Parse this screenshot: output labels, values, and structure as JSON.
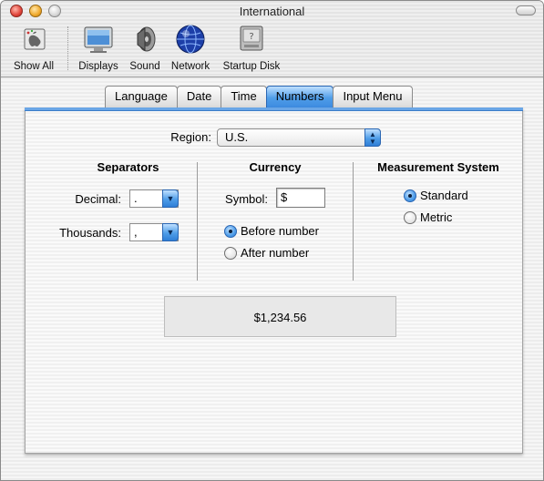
{
  "window": {
    "title": "International"
  },
  "toolbar": {
    "items": [
      {
        "label": "Show All",
        "icon": "apple-icon"
      },
      {
        "label": "Displays",
        "icon": "display-icon"
      },
      {
        "label": "Sound",
        "icon": "speaker-icon"
      },
      {
        "label": "Network",
        "icon": "globe-icon"
      },
      {
        "label": "Startup Disk",
        "icon": "disk-icon"
      }
    ]
  },
  "tabs": [
    {
      "label": "Language",
      "selected": false
    },
    {
      "label": "Date",
      "selected": false
    },
    {
      "label": "Time",
      "selected": false
    },
    {
      "label": "Numbers",
      "selected": true
    },
    {
      "label": "Input Menu",
      "selected": false
    }
  ],
  "region": {
    "label": "Region:",
    "value": "U.S."
  },
  "separators": {
    "title": "Separators",
    "decimal_label": "Decimal:",
    "decimal_value": ".",
    "thousands_label": "Thousands:",
    "thousands_value": ","
  },
  "currency": {
    "title": "Currency",
    "symbol_label": "Symbol:",
    "symbol_value": "$",
    "before_label": "Before number",
    "after_label": "After number",
    "position_selected": "before"
  },
  "measurement": {
    "title": "Measurement System",
    "standard_label": "Standard",
    "metric_label": "Metric",
    "selected": "standard"
  },
  "sample": {
    "value": "$1,234.56"
  },
  "colors": {
    "accent": "#4f9de8",
    "accent_dark": "#2a66b3"
  }
}
